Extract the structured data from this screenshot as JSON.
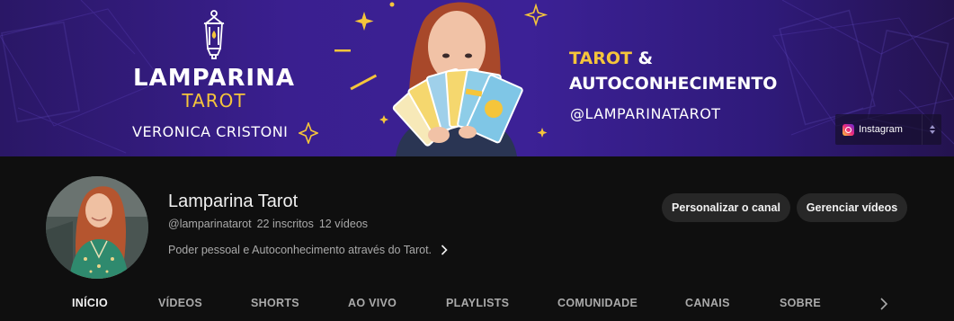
{
  "banner": {
    "brand_name": "LAMPARINA",
    "brand_sub": "TAROT",
    "author": "VERONICA CRISTONI",
    "tagline_word1": "TAROT",
    "tagline_amp": " &",
    "tagline_line2": "AUTOCONHECIMENTO",
    "handle": "@LAMPARINATAROT",
    "link_label": "Instagram",
    "colors": {
      "background": "#3a1f8f",
      "accent": "#f5c53b"
    }
  },
  "channel": {
    "title": "Lamparina Tarot",
    "handle": "@lamparinatarot",
    "subscribers": "22 inscritos",
    "videos": "12 vídeos",
    "description": "Poder pessoal e Autoconhecimento através do Tarot."
  },
  "actions": {
    "customize_label": "Personalizar o canal",
    "manage_label": "Gerenciar vídeos"
  },
  "tabs": [
    {
      "label": "INÍCIO",
      "active": true
    },
    {
      "label": "VÍDEOS",
      "active": false
    },
    {
      "label": "SHORTS",
      "active": false
    },
    {
      "label": "AO VIVO",
      "active": false
    },
    {
      "label": "PLAYLISTS",
      "active": false
    },
    {
      "label": "COMUNIDADE",
      "active": false
    },
    {
      "label": "CANAIS",
      "active": false
    },
    {
      "label": "SOBRE",
      "active": false
    }
  ],
  "icons": {
    "lamp": "lamp-icon",
    "sparkle": "sparkle-icon",
    "instagram": "instagram-icon",
    "more": "more-links-icon",
    "description_chevron": "chevron-right-icon",
    "tabs_scroll": "chevron-right-icon"
  }
}
